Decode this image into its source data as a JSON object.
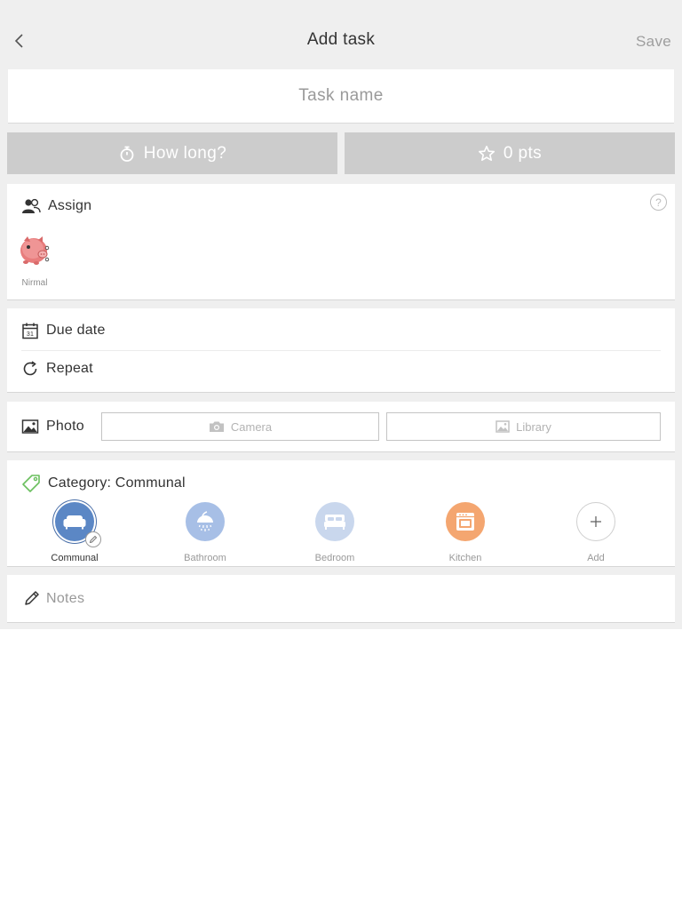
{
  "header": {
    "title": "Add task",
    "save_label": "Save"
  },
  "task": {
    "name_value": "",
    "name_placeholder": "Task name"
  },
  "duration": {
    "label": "How long?"
  },
  "points": {
    "label": "0 pts",
    "value": 0
  },
  "assign": {
    "title": "Assign",
    "help_glyph": "?",
    "members": [
      {
        "name": "Nirmal",
        "avatar": "pig-avatar"
      }
    ]
  },
  "schedule": {
    "due_date_label": "Due date",
    "calendar_day": "31",
    "repeat_label": "Repeat"
  },
  "photo": {
    "title": "Photo",
    "camera_label": "Camera",
    "library_label": "Library"
  },
  "category": {
    "title": "Category: Communal",
    "selected": "Communal",
    "items": [
      {
        "label": "Communal",
        "icon": "sofa-icon",
        "color": "#5b87c5",
        "selected": true
      },
      {
        "label": "Bathroom",
        "icon": "shower-icon",
        "color": "#a7bfe6",
        "selected": false
      },
      {
        "label": "Bedroom",
        "icon": "bed-icon",
        "color": "#c9d7ed",
        "selected": false
      },
      {
        "label": "Kitchen",
        "icon": "oven-icon",
        "color": "#f4a670",
        "selected": false
      },
      {
        "label": "Add",
        "icon": "plus-icon",
        "color": "#ffffff",
        "selected": false
      }
    ]
  },
  "notes": {
    "value": "",
    "placeholder": "Notes"
  },
  "colors": {
    "background": "#efefef",
    "pill": "#cccccc",
    "accent_blue": "#5b87c5",
    "accent_orange": "#f4a670",
    "save_disabled": "#9e9e9e"
  }
}
